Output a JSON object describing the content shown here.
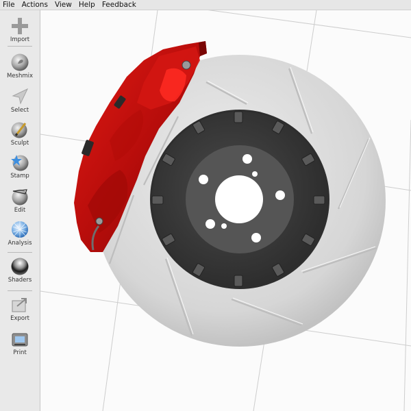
{
  "menu": {
    "file": "File",
    "actions": "Actions",
    "view": "View",
    "help": "Help",
    "feedback": "Feedback"
  },
  "toolbar": {
    "import": "Import",
    "meshmix": "Meshmix",
    "select": "Select",
    "sculpt": "Sculpt",
    "stamp": "Stamp",
    "edit": "Edit",
    "analysis": "Analysis",
    "shaders": "Shaders",
    "export": "Export",
    "print": "Print"
  },
  "icons": {
    "import": "plus-icon",
    "meshmix": "bunny-sphere-icon",
    "select": "arrow-cursor-icon",
    "sculpt": "brush-sphere-icon",
    "stamp": "stamp-sphere-icon",
    "edit": "edit-sphere-icon",
    "analysis": "mesh-sphere-icon",
    "shaders": "chrome-sphere-icon",
    "export": "export-icon",
    "print": "printer-icon"
  },
  "colors": {
    "caliper": "#c8110f",
    "rotor": "#d8d8d8",
    "hub": "#3a3a3a"
  }
}
